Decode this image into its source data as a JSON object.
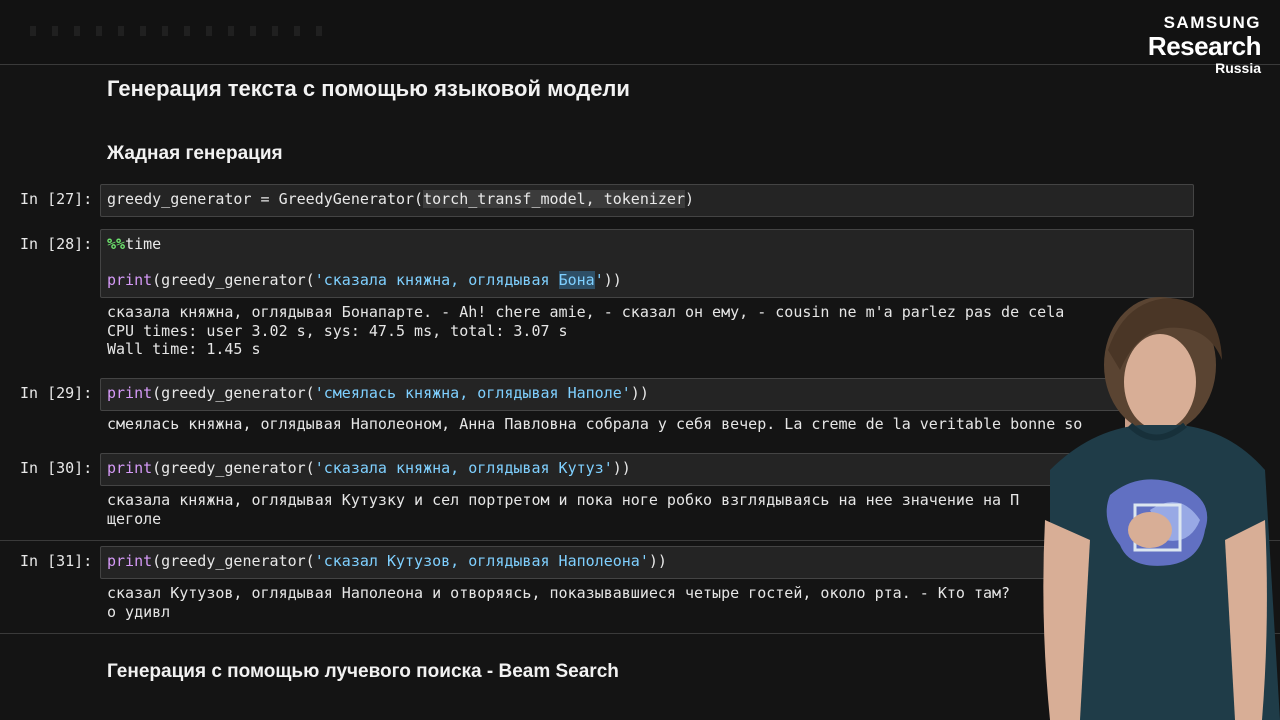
{
  "logo": {
    "line1": "SAMSUNG",
    "line2": "Research",
    "line3": "Russia"
  },
  "headings": {
    "main": "Генерация текста с помощью языковой модели",
    "greedy": "Жадная генерация",
    "beam": "Генерация с помощью лучевого поиска - Beam Search"
  },
  "cells": [
    {
      "prompt": "In [27]:",
      "code_pre": "greedy_generator = GreedyGenerator(",
      "code_args": "torch_transf_model, tokenizer",
      "code_post": ")"
    },
    {
      "prompt": "In [28]:",
      "magic": "%%",
      "magic_cmd": "time",
      "print_kw": "print",
      "call_pre": "(greedy_generator(",
      "str_a": "'сказала княжна, оглядывая ",
      "str_hl": "Бона",
      "str_b": "'",
      "call_post": "))",
      "output": [
        "сказала княжна, оглядывая Бонапарте. - Ah! chere amie, - сказал он ему, - cousin ne m'a parlez pas de cela",
        "CPU times: user 3.02 s, sys: 47.5 ms, total: 3.07 s",
        "Wall time: 1.45 s"
      ]
    },
    {
      "prompt": "In [29]:",
      "print_kw": "print",
      "call_pre": "(greedy_generator(",
      "str": "'смеялась княжна, оглядывая Наполе'",
      "call_post": "))",
      "output": [
        "смеялась княжна, оглядывая Наполеоном, Анна Павловна собрала у себя вечер. La creme de la veritable bonne so"
      ]
    },
    {
      "prompt": "In [30]:",
      "print_kw": "print",
      "call_pre": "(greedy_generator(",
      "str": "'сказала княжна, оглядывая Кутуз'",
      "call_post": "))",
      "output": [
        "сказала княжна, оглядывая Кутузку и сел портретом и пока ноге робко взглядываясь на нее значение на П",
        "щеголе"
      ]
    },
    {
      "prompt": "In [31]:",
      "print_kw": "print",
      "call_pre": "(greedy_generator(",
      "str": "'сказал Кутузов, оглядывая Наполеона'",
      "call_post": "))",
      "output": [
        "сказал Кутузов, оглядывая Наполеона и отворяясь, показывавшиеся четыре гостей, около рта. - Кто там?",
        "о удивл"
      ]
    }
  ],
  "colors": {
    "keyword": "#d59af7",
    "string": "#7fd0ff",
    "magic": "#6ee26e",
    "background": "#141414"
  }
}
